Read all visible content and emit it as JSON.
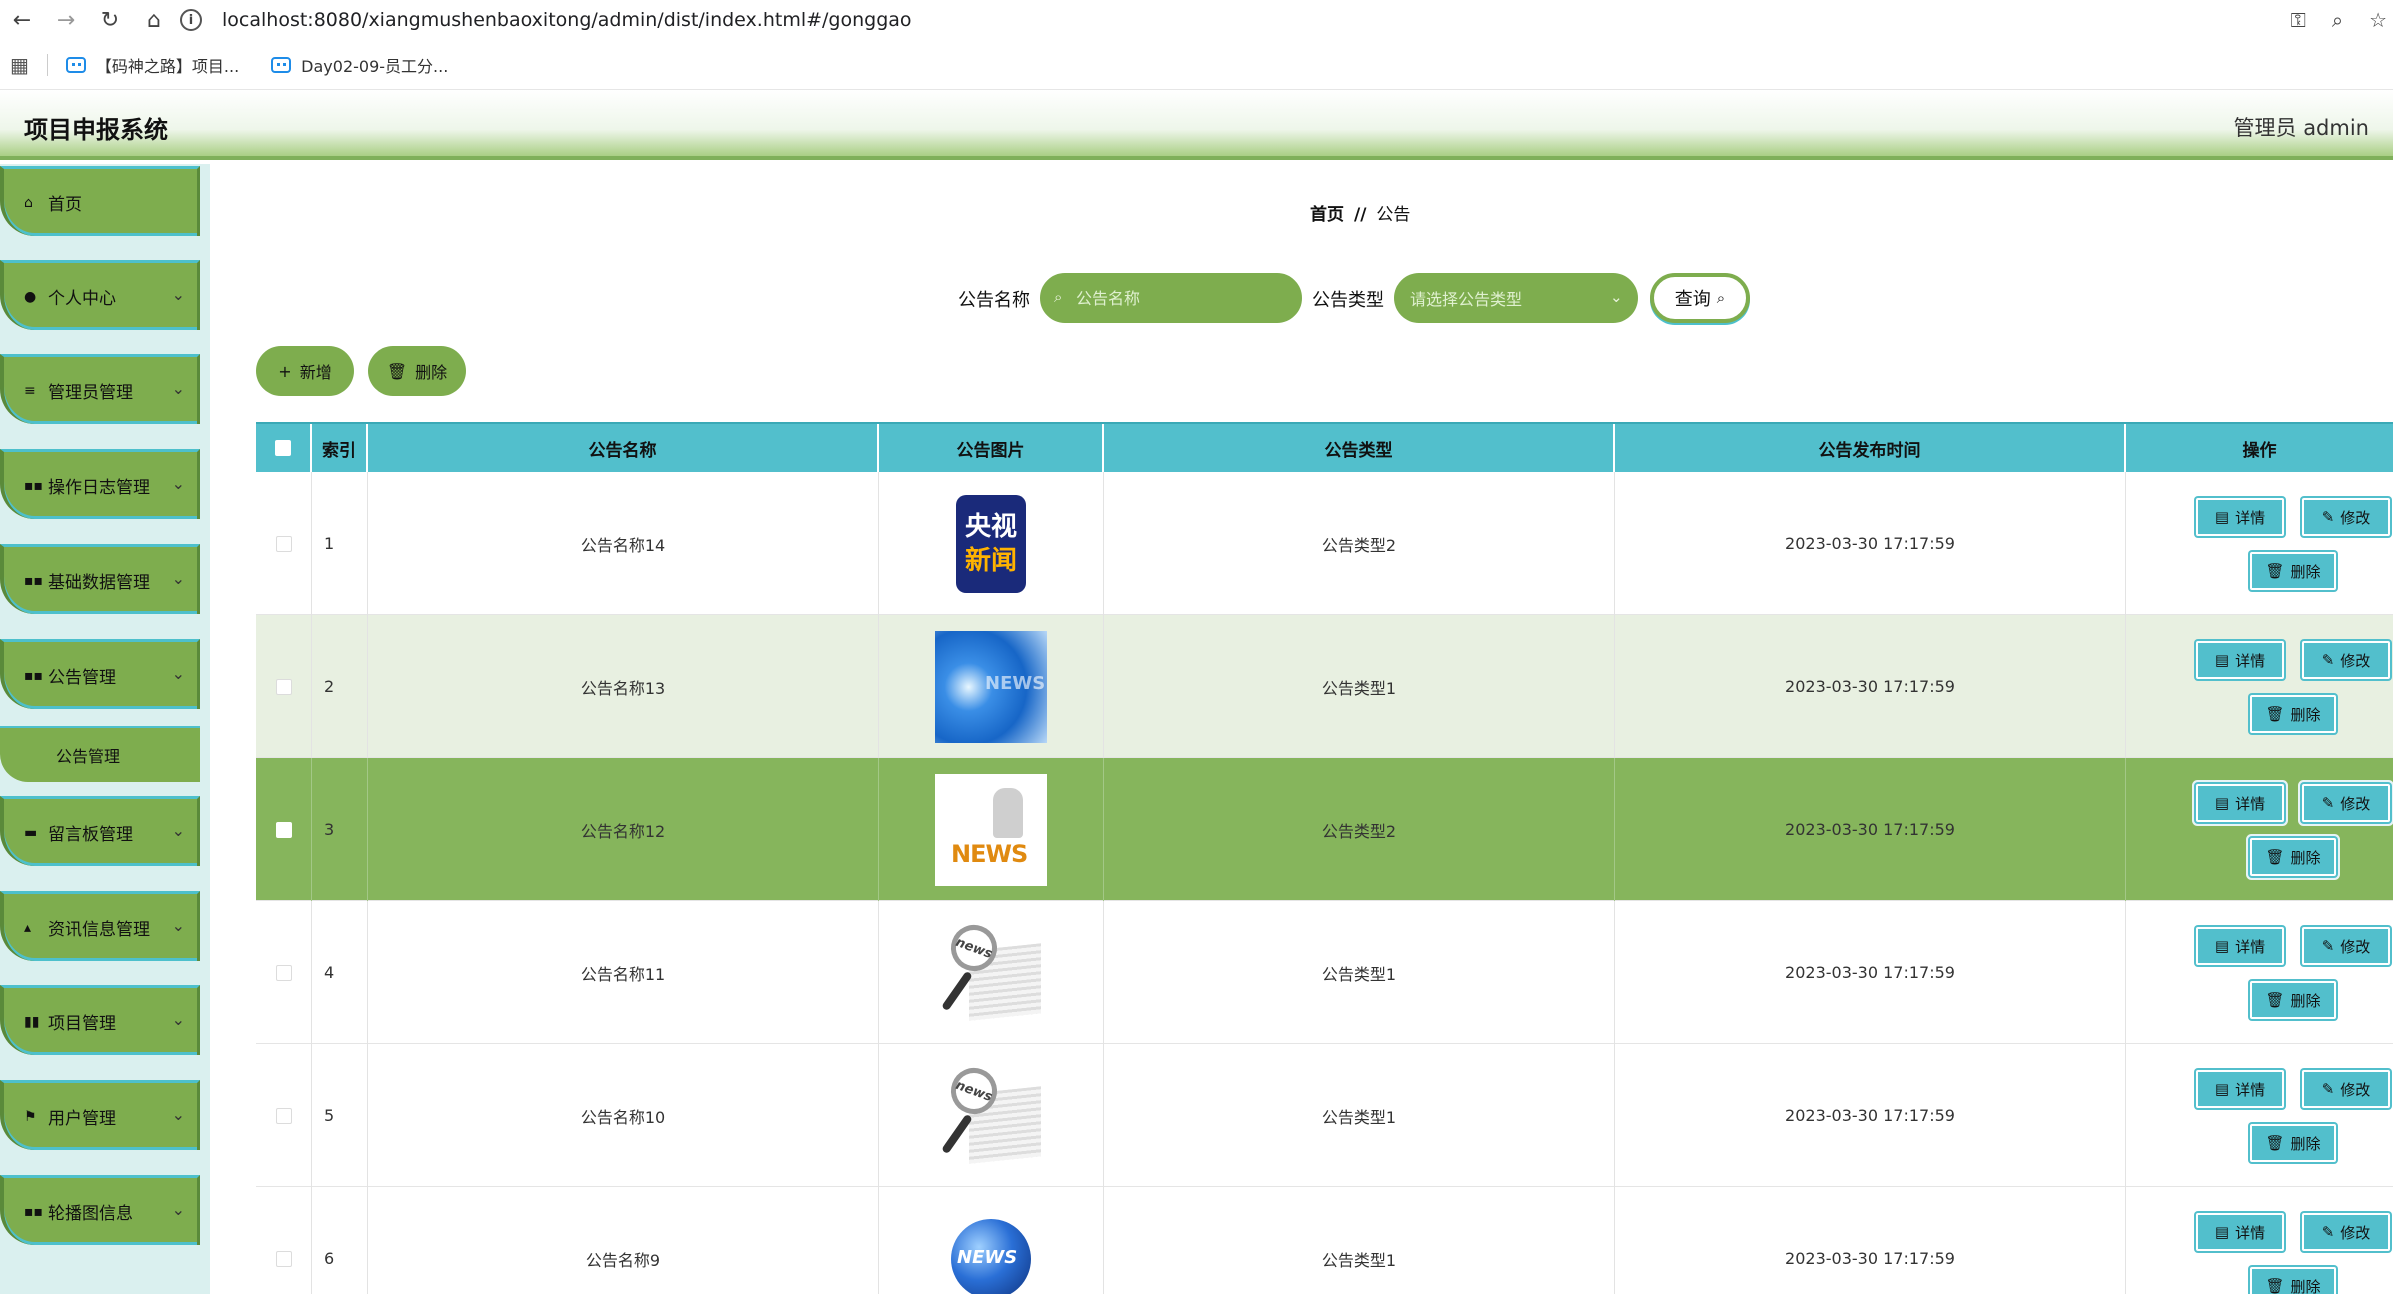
{
  "browser": {
    "url": "localhost:8080/xiangmushenbaoxitong/admin/dist/index.html#/gonggao",
    "bookmarks": [
      "【码神之路】项目...",
      "Day02-09-员工分..."
    ]
  },
  "header": {
    "title": "项目申报系统",
    "user": "管理员 admin"
  },
  "sidebar": {
    "items": [
      {
        "label": "首页",
        "icon": "home-icon"
      },
      {
        "label": "个人中心",
        "icon": "user-icon"
      },
      {
        "label": "管理员管理",
        "icon": "list-icon"
      },
      {
        "label": "操作日志管理",
        "icon": "grid-icon"
      },
      {
        "label": "基础数据管理",
        "icon": "grid-icon"
      },
      {
        "label": "公告管理",
        "icon": "grid-icon"
      },
      {
        "label": "留言板管理",
        "icon": "ticket-icon"
      },
      {
        "label": "资讯信息管理",
        "icon": "thumb-icon"
      },
      {
        "label": "项目管理",
        "icon": "chart-icon"
      },
      {
        "label": "用户管理",
        "icon": "flag-icon"
      },
      {
        "label": "轮播图信息",
        "icon": "grid-icon"
      }
    ],
    "submenu": {
      "label": "公告管理"
    }
  },
  "breadcrumb": {
    "home": "首页",
    "sep": "//",
    "current": "公告"
  },
  "search": {
    "name_label": "公告名称",
    "name_placeholder": "公告名称",
    "type_label": "公告类型",
    "type_placeholder": "请选择公告类型",
    "query_label": "查询"
  },
  "actions": {
    "add_label": "新增",
    "delete_label": "删除"
  },
  "table": {
    "headers": [
      "索引",
      "公告名称",
      "公告图片",
      "公告类型",
      "公告发布时间",
      "操作"
    ],
    "rows": [
      {
        "index": "1",
        "name": "公告名称14",
        "image": "cctv",
        "type": "公告类型2",
        "time": "2023-03-30 17:17:59"
      },
      {
        "index": "2",
        "name": "公告名称13",
        "image": "news-blue",
        "type": "公告类型1",
        "time": "2023-03-30 17:17:59"
      },
      {
        "index": "3",
        "name": "公告名称12",
        "image": "news-3d",
        "type": "公告类型2",
        "time": "2023-03-30 17:17:59"
      },
      {
        "index": "4",
        "name": "公告名称11",
        "image": "magnifier",
        "type": "公告类型1",
        "time": "2023-03-30 17:17:59"
      },
      {
        "index": "5",
        "name": "公告名称10",
        "image": "magnifier",
        "type": "公告类型1",
        "time": "2023-03-30 17:17:59"
      },
      {
        "index": "6",
        "name": "公告名称9",
        "image": "globe",
        "type": "公告类型1",
        "time": "2023-03-30 17:17:59"
      }
    ],
    "op_detail": "详情",
    "op_edit": "修改",
    "op_delete": "删除"
  },
  "images": {
    "cctv_line1": "央视",
    "cctv_line2": "新闻",
    "news_lens": "news"
  },
  "colors": {
    "accent_green": "#7ead4e",
    "accent_cyan": "#52bfcc"
  }
}
